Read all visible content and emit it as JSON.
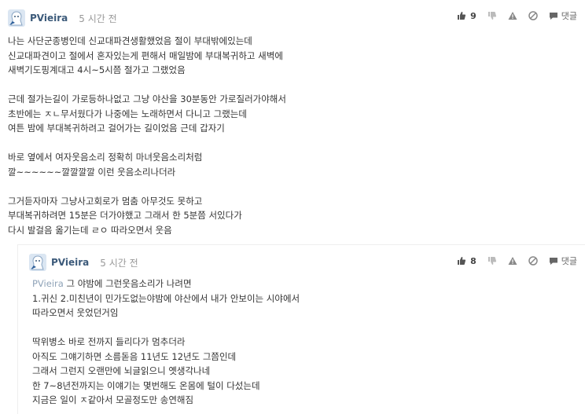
{
  "comments": [
    {
      "author": "PVieira",
      "time": "5 시간 전",
      "likes": "9",
      "reply_label": "댓글",
      "paragraphs": [
        [
          "나는 사단군종병인데 신교대파견생활했었음 절이 부대밖에있는데",
          "신교대파견이고 절에서 혼자있는게 편해서 매일밤에 부대복귀하고 새벽에",
          "새벽기도핑계대고 4시~5시쯤 절가고 그랬었음"
        ],
        [
          "근데 절가는길이 가로등하나없고 그냥 야산을 30분동안 가로질러가야해서",
          "초반에는 ㅈㄴ무서웠다가 나중에는 노래하면서 다니고 그랬는데",
          "여튼 밤에 부대복귀하려고 걸어가는 길이었음 근데 갑자기"
        ],
        [
          "바로 옆에서 여자웃음소리 정확히 마녀웃음소리처럼",
          "깔~~~~~~깔깔깔깔 이런 웃음소리나더라"
        ],
        [
          "그거듣자마자 그냥사고회로가 멈춤 아무것도 못하고",
          "부대복귀하려면 15분은 더가야했고 그래서 한 5분쯤 서있다가",
          "다시 발걸음 옮기는데 ㄹㅇ 따라오면서 웃음"
        ]
      ]
    },
    {
      "author": "PVieira",
      "time": "5 시간 전",
      "likes": "8",
      "reply_label": "댓글",
      "mention": "PVieira",
      "first_line_rest": " 그 야밤에 그런웃음소리가 나려면",
      "paragraphs": [
        [
          "1.귀신 2.미친년이 민가도없는야밤에 야산에서 내가 안보이는 시야에서",
          "따라오면서 웃었던거임"
        ],
        [
          "딱위병소 바로 전까지 들리다가 멈추더라",
          "아직도 그얘기하면 소름돋음 11년도 12년도 그쯤인데",
          "그래서 그런지 오랜만에 뇌글읽으니 옛생각나네",
          "한 7~8년전까지는 이얘기는 몇번해도 온몸에 털이 다섰는데",
          "지금은 일이 ㅈ같아서 모골정도만 송연해짐"
        ]
      ]
    }
  ],
  "icons": {
    "like": "thumbs-up-icon",
    "dislike": "thumbs-down-icon",
    "report": "warning-icon",
    "block": "block-icon",
    "reply": "reply-icon"
  },
  "colors": {
    "author": "#3c5a7a",
    "mention": "#8fa3b8",
    "time": "#999999"
  }
}
